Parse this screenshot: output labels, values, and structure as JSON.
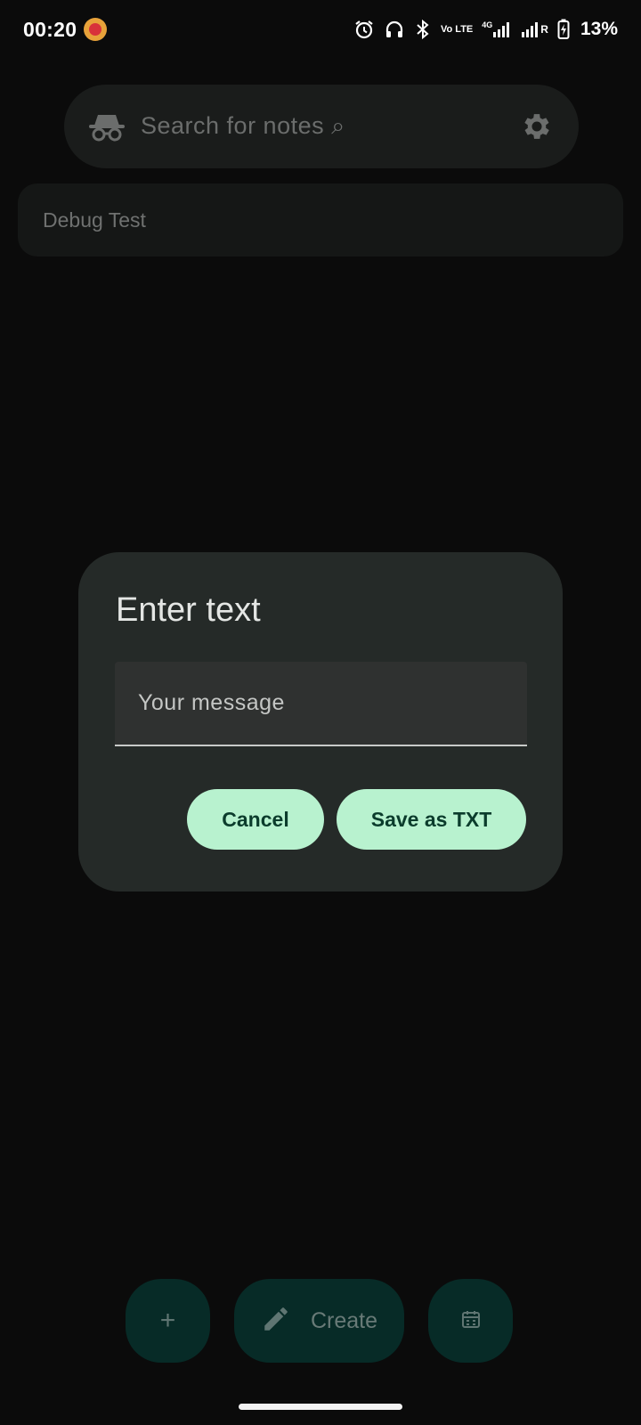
{
  "status_bar": {
    "time": "00:20",
    "network": "4G",
    "volte": "Vo LTE",
    "roaming": "R",
    "battery": "13%"
  },
  "search": {
    "placeholder": "Search for notes ⌕"
  },
  "notes": [
    {
      "title": "Debug Test"
    }
  ],
  "dialog": {
    "title": "Enter text",
    "input_placeholder": "Your message",
    "input_value": "",
    "cancel_label": "Cancel",
    "save_label": "Save as TXT"
  },
  "fabs": {
    "add_label": "+",
    "create_label": "Create"
  },
  "colors": {
    "background": "#0b0b0b",
    "dialog_bg": "#252a28",
    "button_bg": "#b8f2cf",
    "button_text": "#0b3c2c",
    "fab_bg": "#072b27"
  }
}
